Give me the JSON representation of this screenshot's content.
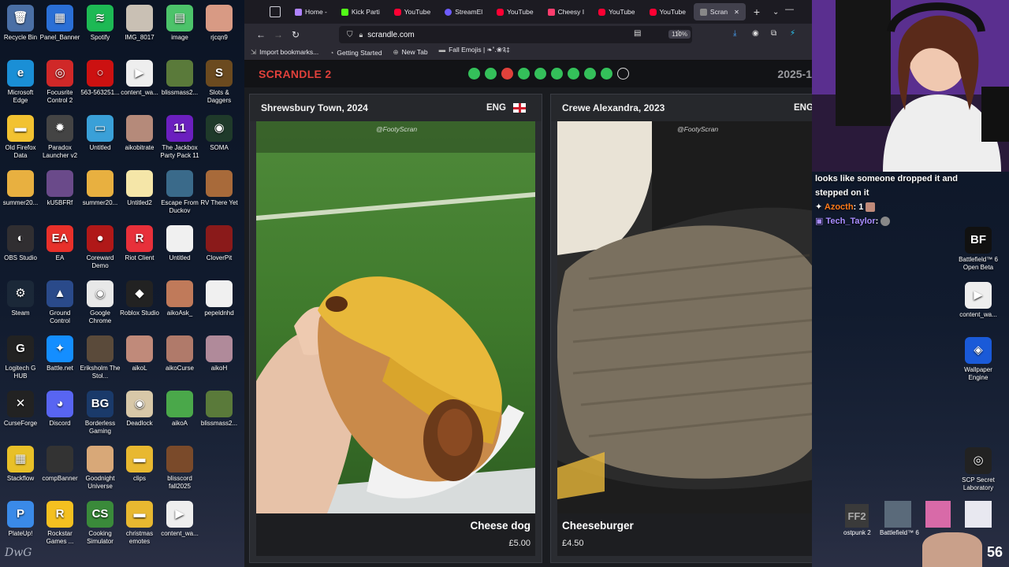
{
  "desktop": {
    "icons": [
      {
        "label": "Recycle Bin",
        "color": "#4a6fa5",
        "glyph": "🗑"
      },
      {
        "label": "Panel_Banner",
        "color": "#2a6fd6",
        "glyph": "▦"
      },
      {
        "label": "Spotify",
        "color": "#1db954",
        "glyph": "≋"
      },
      {
        "label": "IMG_8017",
        "color": "#c9c0b4",
        "glyph": ""
      },
      {
        "label": "image",
        "color": "#4cc36a",
        "glyph": "▤"
      },
      {
        "label": "rjcqn9",
        "color": "#d89a84",
        "glyph": ""
      },
      {
        "label": "Microsoft Edge",
        "color": "#1a8fd6",
        "glyph": "e"
      },
      {
        "label": "Focusrite Control 2",
        "color": "#d02828",
        "glyph": "◎"
      },
      {
        "label": "563-563251...",
        "color": "#c11",
        "glyph": "○"
      },
      {
        "label": "content_wa...",
        "color": "#eeeeee",
        "glyph": "▶"
      },
      {
        "label": "blissmass2...",
        "color": "#5a7a3a",
        "glyph": ""
      },
      {
        "label": "Slots & Daggers",
        "color": "#6b4a1f",
        "glyph": "S"
      },
      {
        "label": "Old Firefox Data",
        "color": "#f2c231",
        "glyph": "▬"
      },
      {
        "label": "Paradox Launcher v2",
        "color": "#444",
        "glyph": "✹"
      },
      {
        "label": "Untitled",
        "color": "#3aa0d8",
        "glyph": "▭"
      },
      {
        "label": "aikobitrate",
        "color": "#b58a7a",
        "glyph": ""
      },
      {
        "label": "The Jackbox Party Pack 11",
        "color": "#6b1fbf",
        "glyph": "11"
      },
      {
        "label": "SOMA",
        "color": "#1f3a2a",
        "glyph": "◉"
      },
      {
        "label": "summer20...",
        "color": "#e8b040",
        "glyph": ""
      },
      {
        "label": "kU5BFRf",
        "color": "#6a4a8a",
        "glyph": ""
      },
      {
        "label": "summer20...",
        "color": "#e8b040",
        "glyph": ""
      },
      {
        "label": "Untitled2",
        "color": "#f5e6a8",
        "glyph": ""
      },
      {
        "label": "Escape From Duckov",
        "color": "#3a6a8a",
        "glyph": ""
      },
      {
        "label": "RV There Yet",
        "color": "#a86a3a",
        "glyph": ""
      },
      {
        "label": "OBS Studio",
        "color": "#302e31",
        "glyph": "◐"
      },
      {
        "label": "EA",
        "color": "#e8302a",
        "glyph": "EA"
      },
      {
        "label": "Coreward Demo",
        "color": "#b01818",
        "glyph": "●"
      },
      {
        "label": "Riot Client",
        "color": "#e8303a",
        "glyph": "R"
      },
      {
        "label": "Untitled",
        "color": "#f0f0f0",
        "glyph": ""
      },
      {
        "label": "CloverPit",
        "color": "#8a1a1a",
        "glyph": ""
      },
      {
        "label": "Steam",
        "color": "#1b2838",
        "glyph": "⚙"
      },
      {
        "label": "Ground Control",
        "color": "#2a4a8a",
        "glyph": "▲"
      },
      {
        "label": "Google Chrome",
        "color": "#e8e8e8",
        "glyph": "◉"
      },
      {
        "label": "Roblox Studio",
        "color": "#222",
        "glyph": "◆"
      },
      {
        "label": "aikoAsk_",
        "color": "#c07a5a",
        "glyph": ""
      },
      {
        "label": "pepeldnhd",
        "color": "#f0f0f0",
        "glyph": ""
      },
      {
        "label": "Logitech G HUB",
        "color": "#222",
        "glyph": "G"
      },
      {
        "label": "Battle.net",
        "color": "#148eff",
        "glyph": "✦"
      },
      {
        "label": "Erikshol​m The Stol...",
        "color": "#5a4a3a",
        "glyph": ""
      },
      {
        "label": "aikoL",
        "color": "#c08a7a",
        "glyph": ""
      },
      {
        "label": "aikoCurse",
        "color": "#b07a6a",
        "glyph": ""
      },
      {
        "label": "aikoH",
        "color": "#b08a9a",
        "glyph": ""
      },
      {
        "label": "CurseForge",
        "color": "#222",
        "glyph": "✕"
      },
      {
        "label": "Discord",
        "color": "#5865f2",
        "glyph": "◕"
      },
      {
        "label": "Borderless Gaming",
        "color": "#1a3a6a",
        "glyph": "BG"
      },
      {
        "label": "Deadlock",
        "color": "#d8c8a8",
        "glyph": "◉"
      },
      {
        "label": "aikoA",
        "color": "#4aa84a",
        "glyph": ""
      },
      {
        "label": "blissmass2...",
        "color": "#5a7a3a",
        "glyph": ""
      },
      {
        "label": "Stackflow",
        "color": "#e8c028",
        "glyph": "▦"
      },
      {
        "label": "compBanner",
        "color": "#333",
        "glyph": ""
      },
      {
        "label": "Goodnight Universe",
        "color": "#d8a878",
        "glyph": ""
      },
      {
        "label": "clips",
        "color": "#e8b830",
        "glyph": "▬"
      },
      {
        "label": "blisscord fall2025",
        "color": "#7a4a2a",
        "glyph": ""
      },
      {
        "label": "PlateUp!",
        "color": "#3a8ae8",
        "glyph": "P"
      },
      {
        "label": "Rockstar Games ...",
        "color": "#f4c020",
        "glyph": "R"
      },
      {
        "label": "Cooking Simulator",
        "color": "#3a8a3a",
        "glyph": "CS"
      },
      {
        "label": "christmas emotes",
        "color": "#e8b830",
        "glyph": "▬"
      },
      {
        "label": "content_wa...",
        "color": "#eeeeee",
        "glyph": "▶"
      }
    ],
    "signature": "DwG"
  },
  "browser": {
    "tabs": [
      {
        "label": "Home -",
        "fav": "fav-home"
      },
      {
        "label": "Kick Parti",
        "fav": "fav-kick"
      },
      {
        "label": "YouTube",
        "fav": "fav-yt"
      },
      {
        "label": "StreamEl",
        "fav": "fav-se"
      },
      {
        "label": "YouTube",
        "fav": "fav-yt"
      },
      {
        "label": "Cheesy I",
        "fav": "fav-cheesy"
      },
      {
        "label": "YouTube",
        "fav": "fav-yt"
      },
      {
        "label": "YouTube",
        "fav": "fav-yt"
      },
      {
        "label": "Scran",
        "fav": "fav-scr",
        "active": true
      }
    ],
    "url": "scrandle.com",
    "zoom": "110%",
    "bookmarks": [
      "Import bookmarks...",
      "Getting Started",
      "New Tab",
      "Fall Emojis | ❧˚.❀༉‡"
    ]
  },
  "scrandle": {
    "brand": "SCRANDLE 2",
    "date": "2025-1",
    "progress": [
      "g",
      "g",
      "r",
      "g",
      "g",
      "g",
      "g",
      "g",
      "g",
      "e"
    ],
    "left": {
      "team": "Shrewsbury Town, 2024",
      "country": "ENG",
      "watermark": "@FootyScran",
      "item": "Cheese dog",
      "price": "£5.00"
    },
    "right": {
      "team": "Crewe Alexandra, 2023",
      "country": "ENG",
      "watermark": "@FootyScran",
      "item": "Cheeseburger",
      "price": "£4.50"
    }
  },
  "chat": {
    "line1a": "looks like someone dropped it and",
    "line1b": "stepped on it",
    "user1": "Azocth",
    "msg1": ": 1",
    "user2": "Tech_Taylor",
    "msg2": ":"
  },
  "desktop_right": [
    {
      "label": "Battlefield™ 6 Open Beta",
      "color": "#111",
      "glyph": "BF"
    },
    {
      "label": "content_wa...",
      "color": "#eeeeee",
      "glyph": "▶"
    },
    {
      "label": "Wallpaper Engine",
      "color": "#1a5ad8",
      "glyph": "◈"
    },
    {
      "label": "SCP Secret Laboratory",
      "color": "#222",
      "glyph": "◎"
    }
  ],
  "taskbar_corner": {
    "labels": [
      "ostpunk 2",
      "Battlefield™ 6"
    ],
    "clock": "56"
  }
}
